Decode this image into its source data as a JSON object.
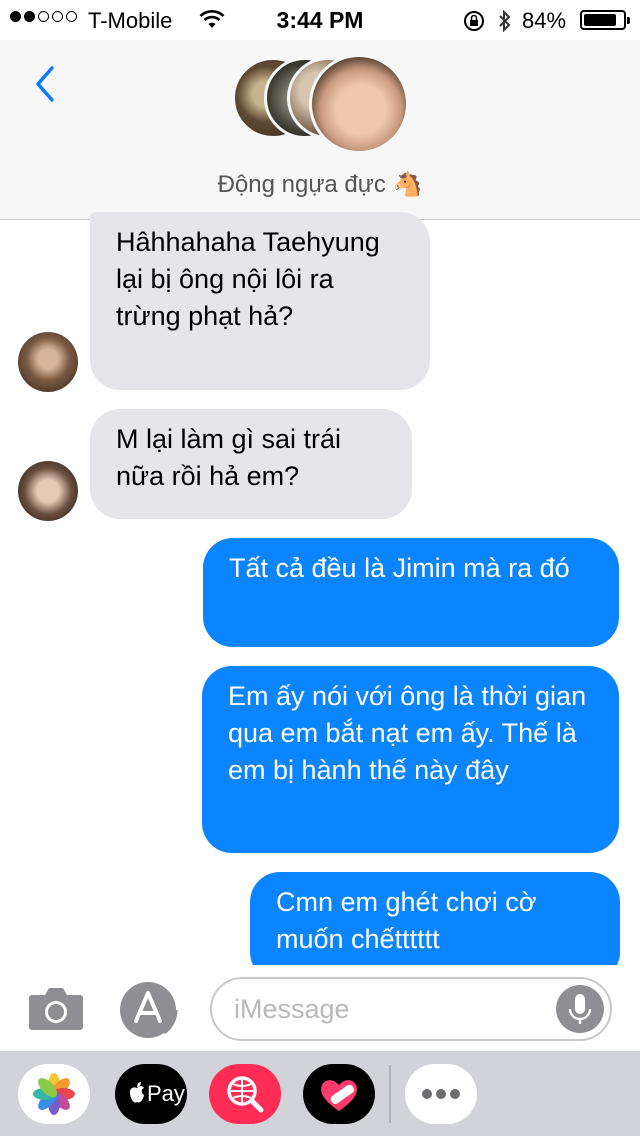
{
  "status_bar": {
    "signal_dots_filled": 2,
    "signal_dots_total": 5,
    "carrier": "T-Mobile",
    "time": "3:44 PM",
    "battery_percent_label": "84%",
    "battery_level": 0.84
  },
  "header": {
    "group_name": "Động ngựa đực",
    "group_emoji": "🐴",
    "back_icon": "chevron-left-icon"
  },
  "messages": [
    {
      "direction": "received",
      "text": "Hâhhahaha Taehyung lại bị ông nội lôi ra trừng phạt hả?"
    },
    {
      "direction": "received",
      "text": "M lại làm gì sai trái nữa rồi hả em?"
    },
    {
      "direction": "sent",
      "text": "Tất cả đều là Jimin mà ra đó"
    },
    {
      "direction": "sent",
      "text": "Em ấy nói với ông là thời gian qua em bắt nạt em ấy. Thế là em bị hành thế này đây"
    },
    {
      "direction": "sent",
      "text": "Cmn em ghét chơi cờ muốn chếtttttt"
    }
  ],
  "input": {
    "placeholder": "iMessage",
    "camera_icon": "camera-icon",
    "apps_icon": "app-store-icon",
    "mic_icon": "microphone-icon"
  },
  "app_drawer": {
    "apps": [
      {
        "name": "photos-app-icon"
      },
      {
        "name": "apple-pay-app-icon",
        "label": "Pay"
      },
      {
        "name": "web-search-app-icon"
      },
      {
        "name": "digital-touch-app-icon"
      },
      {
        "name": "more-apps-icon"
      }
    ]
  },
  "colors": {
    "sent_bubble": "#0b84ff",
    "received_bubble": "#e5e5ea",
    "accent": "#0a7aff"
  }
}
